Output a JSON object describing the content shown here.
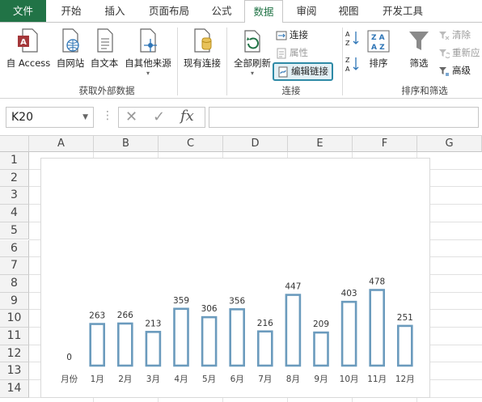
{
  "ribbon_tabs": [
    {
      "label": "文件",
      "name": "tab-file"
    },
    {
      "label": "开始",
      "name": "tab-home"
    },
    {
      "label": "插入",
      "name": "tab-insert"
    },
    {
      "label": "页面布局",
      "name": "tab-page-layout"
    },
    {
      "label": "公式",
      "name": "tab-formulas"
    },
    {
      "label": "数据",
      "name": "tab-data"
    },
    {
      "label": "审阅",
      "name": "tab-review"
    },
    {
      "label": "视图",
      "name": "tab-view"
    },
    {
      "label": "开发工具",
      "name": "tab-developer"
    }
  ],
  "active_tab": "数据",
  "accent_color": "#217346",
  "ribbon": {
    "external": {
      "access": "自 Access",
      "web": "自网站",
      "text": "自文本",
      "other": "自其他来源",
      "group_label": "获取外部数据"
    },
    "existing": "现有连接",
    "connections": {
      "refresh_all": "全部刷新",
      "connections": "连接",
      "properties": "属性",
      "edit_links": "编辑链接",
      "group_label": "连接"
    },
    "sort_filter": {
      "sort": "排序",
      "filter": "筛选",
      "clear": "清除",
      "reapply": "重新应",
      "advanced": "高级",
      "group_label": "排序和筛选"
    }
  },
  "formula_bar": {
    "name_box": "K20",
    "fx": "fx",
    "formula": ""
  },
  "grid": {
    "columns": [
      "A",
      "B",
      "C",
      "D",
      "E",
      "F",
      "G"
    ],
    "rows": [
      "1",
      "2",
      "3",
      "4",
      "5",
      "6",
      "7",
      "8",
      "9",
      "10",
      "11",
      "12",
      "13",
      "14"
    ]
  },
  "chart_data": {
    "type": "bar",
    "categories": [
      "月份",
      "1月",
      "2月",
      "3月",
      "4月",
      "5月",
      "6月",
      "7月",
      "8月",
      "9月",
      "10月",
      "11月",
      "12月"
    ],
    "values": [
      0,
      263,
      266,
      213,
      359,
      306,
      356,
      216,
      447,
      209,
      403,
      478,
      251
    ],
    "bar_style": "outline",
    "bar_color": "#6b9bbd",
    "ylim": [
      0,
      500
    ],
    "grid": false,
    "legend": "none"
  }
}
